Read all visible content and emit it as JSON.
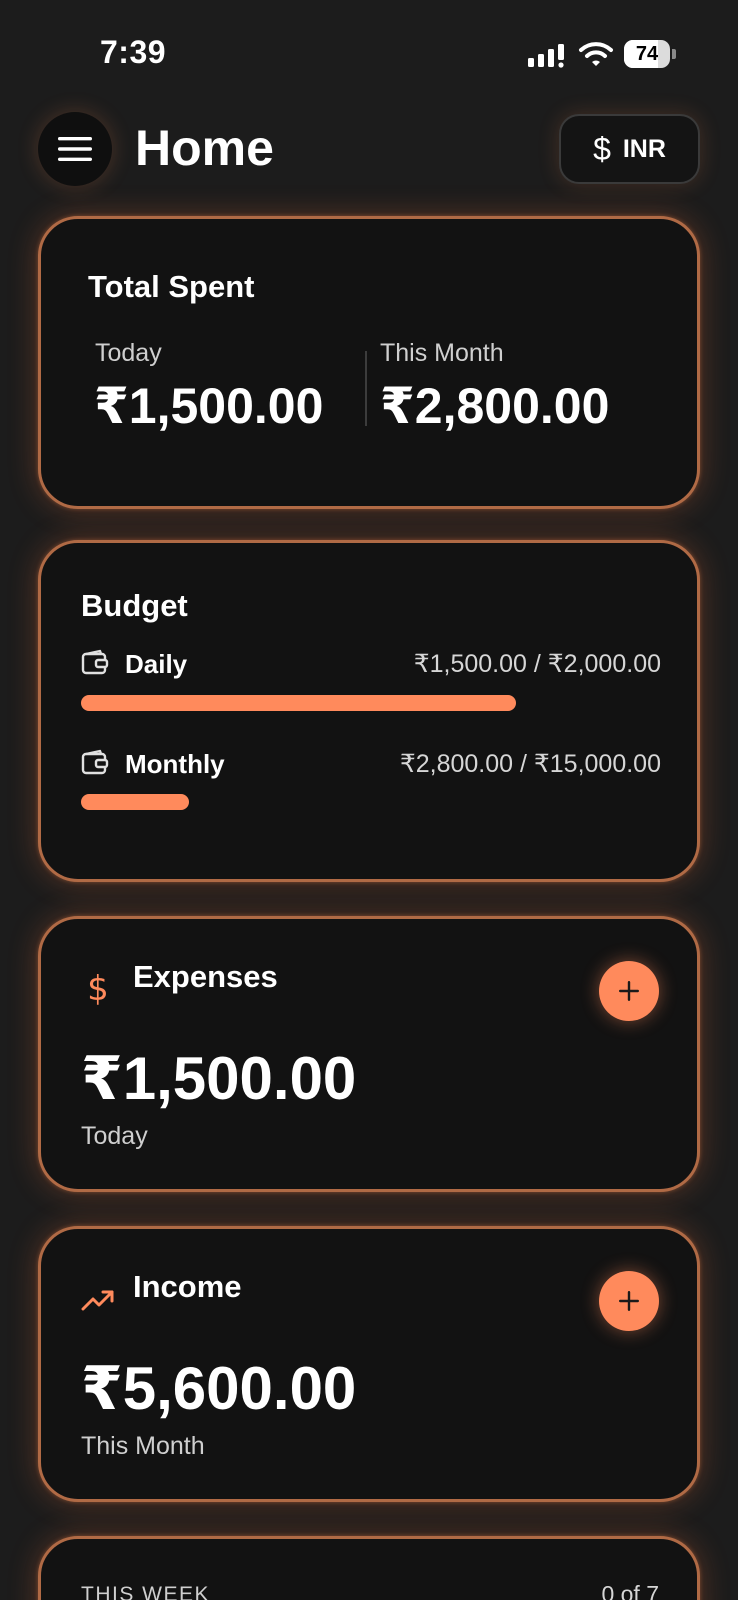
{
  "status_bar": {
    "time": "7:39",
    "battery_level": "74",
    "battery_fraction": 0.74
  },
  "header": {
    "title": "Home",
    "currency_symbol": "$",
    "currency_code": "INR"
  },
  "total_spent": {
    "title": "Total Spent",
    "today_label": "Today",
    "today_value": "₹1,500.00",
    "month_label": "This Month",
    "month_value": "₹2,800.00"
  },
  "budget": {
    "title": "Budget",
    "rows": [
      {
        "label": "Daily",
        "amount": "₹1,500.00 / ₹2,000.00",
        "progress_fraction": 0.75
      },
      {
        "label": "Monthly",
        "amount": "₹2,800.00 / ₹15,000.00",
        "progress_fraction": 0.187
      }
    ]
  },
  "expenses": {
    "title": "Expenses",
    "icon": "dollar-icon",
    "value": "₹1,500.00",
    "period": "Today",
    "add_symbol": "+"
  },
  "income": {
    "title": "Income",
    "icon": "trending-up-icon",
    "value": "₹5,600.00",
    "period": "This Month",
    "add_symbol": "+"
  },
  "this_week": {
    "label": "THIS WEEK",
    "count": "0 of 7"
  },
  "colors": {
    "accent": "#ff8a5c",
    "card_border": "#b06a45",
    "background": "#1c1c1c",
    "card_background": "#121212"
  }
}
